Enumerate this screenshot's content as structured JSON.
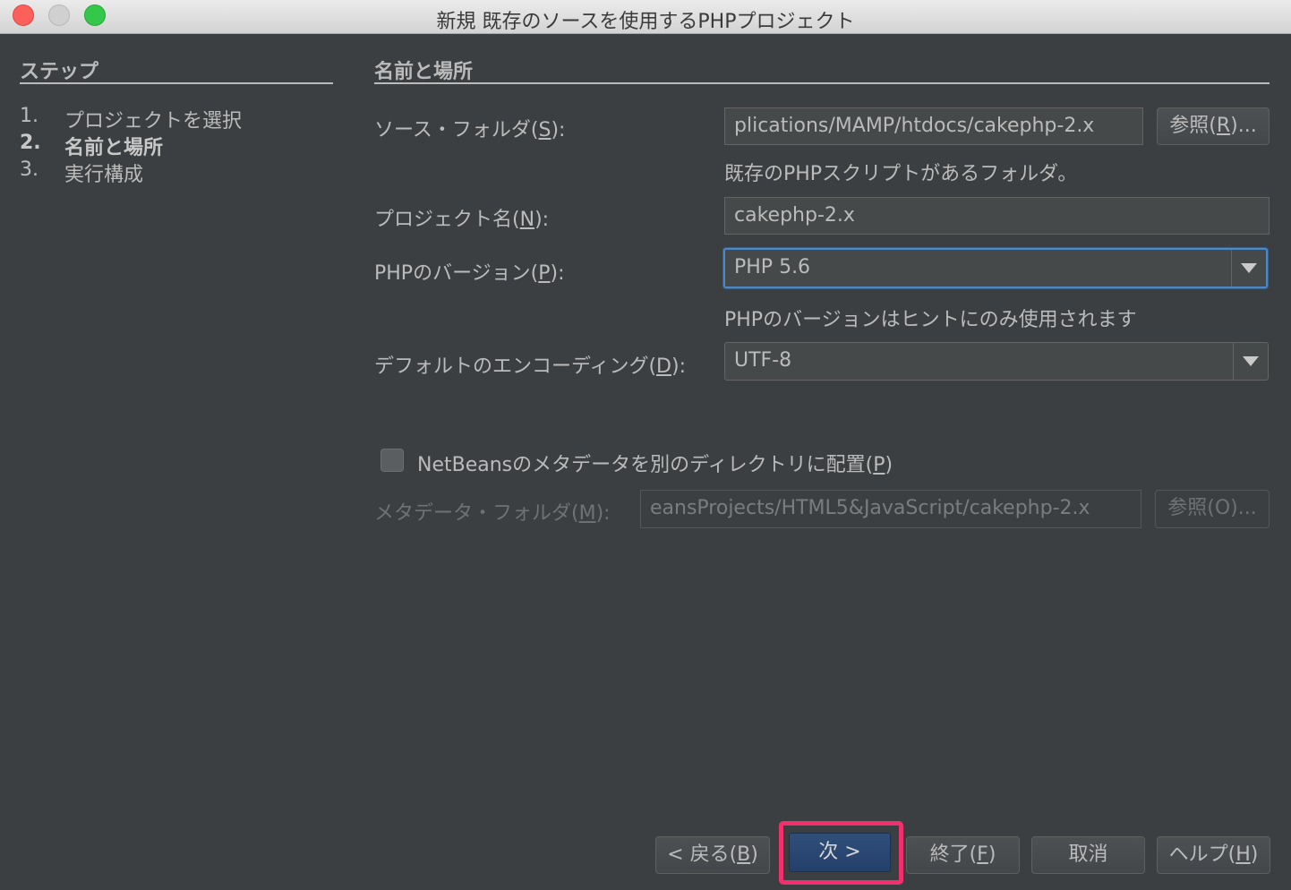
{
  "window": {
    "title": "新規 既存のソースを使用するPHPプロジェクト"
  },
  "steps": {
    "header": "ステップ",
    "items": [
      {
        "num": "1.",
        "label": "プロジェクトを選択"
      },
      {
        "num": "2.",
        "label": "名前と場所"
      },
      {
        "num": "3.",
        "label": "実行構成"
      }
    ]
  },
  "panel": {
    "header": "名前と場所",
    "source_folder": {
      "label_pre": "ソース・フォルダ(",
      "label_mn": "S",
      "label_post": "):",
      "value": "plications/MAMP/htdocs/cakephp-2.x",
      "browse_pre": "参照(",
      "browse_mn": "R",
      "browse_post": ")...",
      "hint": "既存のPHPスクリプトがあるフォルダ。"
    },
    "project_name": {
      "label_pre": "プロジェクト名(",
      "label_mn": "N",
      "label_post": "):",
      "value": "cakephp-2.x"
    },
    "php_version": {
      "label_pre": "PHPのバージョン(",
      "label_mn": "P",
      "label_post": "):",
      "value": "PHP 5.6",
      "hint": "PHPのバージョンはヒントにのみ使用されます"
    },
    "encoding": {
      "label_pre": "デフォルトのエンコーディング(",
      "label_mn": "D",
      "label_post": "):",
      "value": "UTF-8"
    },
    "metadata_checkbox": {
      "label_pre": "NetBeansのメタデータを別のディレクトリに配置(",
      "label_mn": "P",
      "label_post": ")",
      "checked": false
    },
    "metadata_folder": {
      "label_pre": "メタデータ・フォルダ(",
      "label_mn": "M",
      "label_post": "):",
      "value": "eansProjects/HTML5&JavaScript/cakephp-2.x",
      "browse": "参照(O)..."
    }
  },
  "footer": {
    "back_pre": "< 戻る(",
    "back_mn": "B",
    "back_post": ")",
    "next": "次 >",
    "finish_pre": "終了(",
    "finish_mn": "F",
    "finish_post": ")",
    "cancel": "取消",
    "help_pre": "ヘルプ(",
    "help_mn": "H",
    "help_post": ")"
  },
  "colors": {
    "background": "#3c3f41",
    "focus": "#4a88c7",
    "highlight": "#f2306e",
    "primary_button": "#2f4f7a"
  }
}
